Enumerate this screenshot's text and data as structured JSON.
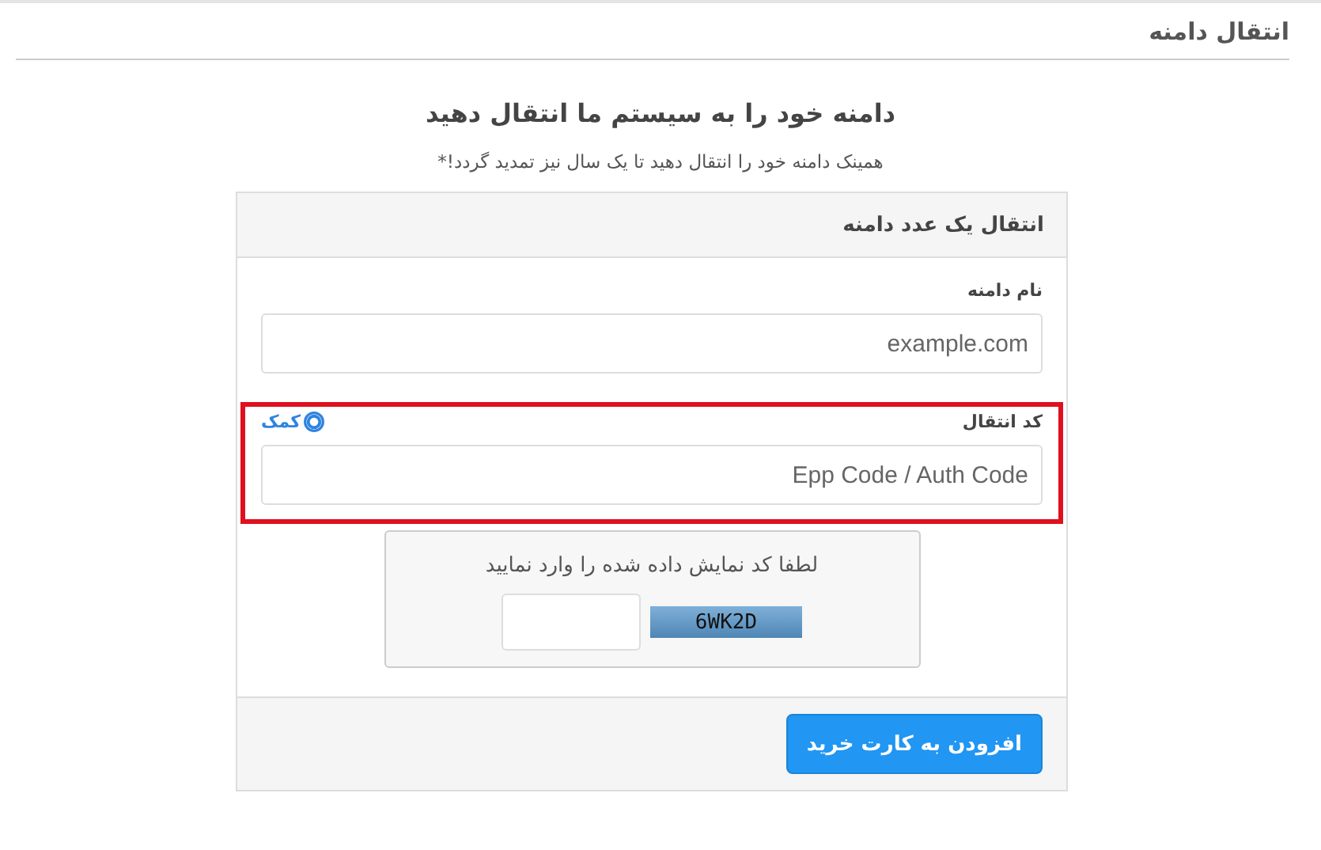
{
  "page_title": "انتقال دامنه",
  "heading": "دامنه خود را به سیستم ما انتقال دهید",
  "subheading": "همینک دامنه خود را انتقال دهید تا یک سال نیز تمدید گردد!*",
  "card": {
    "title": "انتقال یک عدد دامنه",
    "fields": [
      {
        "label": "نام دامنه",
        "placeholder": "example.com",
        "highlighted": false
      },
      {
        "label": "کد انتقال",
        "placeholder": "Epp Code / Auth Code",
        "help_link": "کمک",
        "highlighted": true
      }
    ],
    "captcha": {
      "prompt": "لطفا کد نمایش داده شده را وارد نمایید",
      "code": "6WK2D"
    },
    "submit_button": "افزودن به کارت خرید"
  }
}
